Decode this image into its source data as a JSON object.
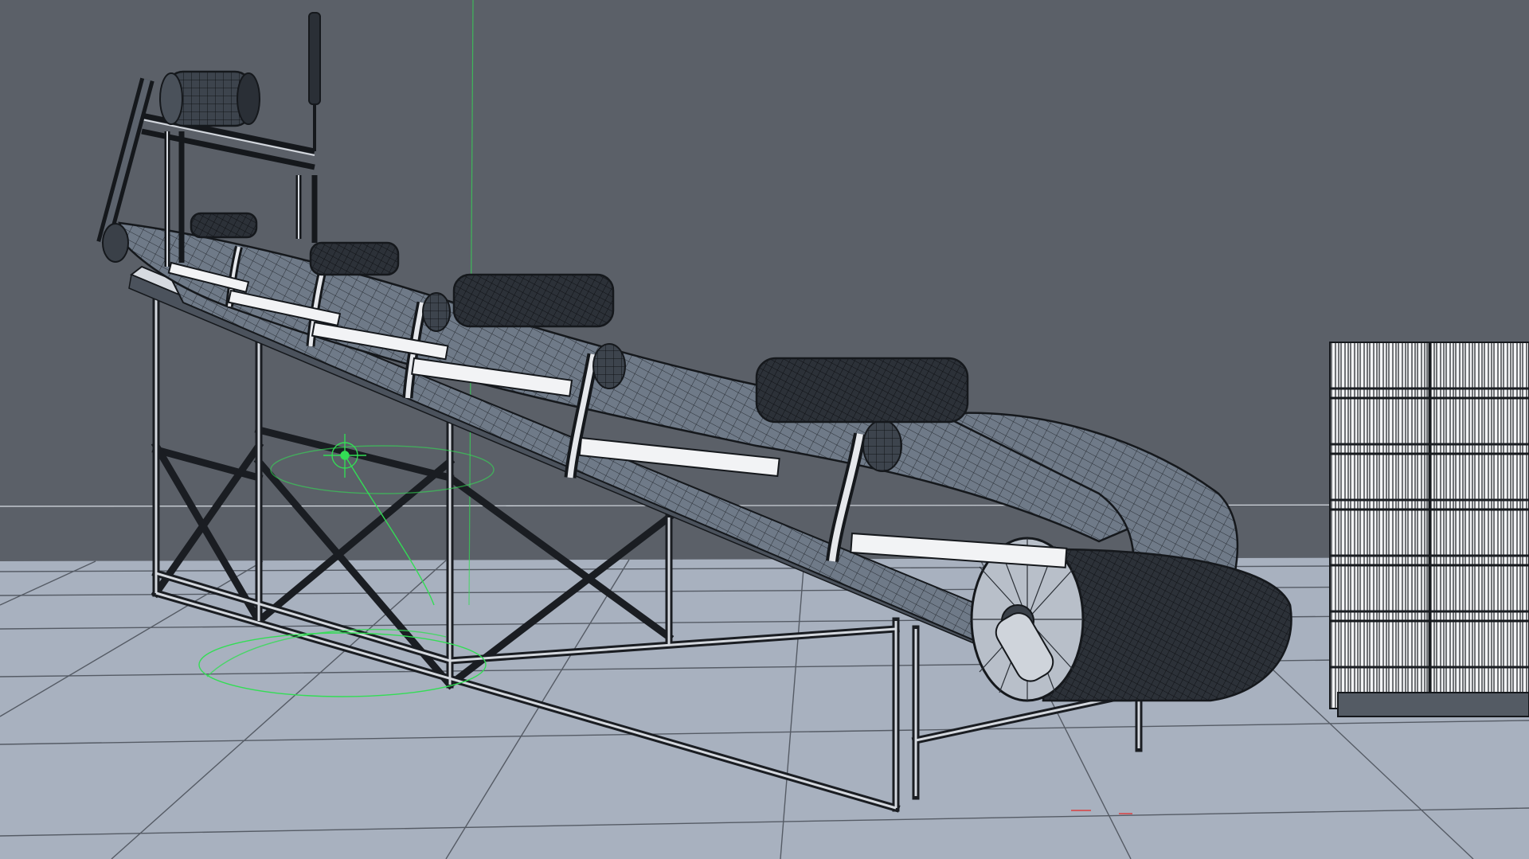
{
  "viewport": {
    "background_color": "#5b6068",
    "floor_color": "#a8b1bf",
    "grid_line_color": "#3a3f47",
    "horizon_line_color": "#d8dde4",
    "wire_dark": "#15181c",
    "wire_light": "#f2f3f5",
    "gizmo_color": "#33dd55"
  },
  "objects": {
    "conveyor": {
      "label": ""
    },
    "pallet": {
      "label": ""
    },
    "transform_gizmo": {
      "icon": "move-gizmo-icon"
    }
  }
}
